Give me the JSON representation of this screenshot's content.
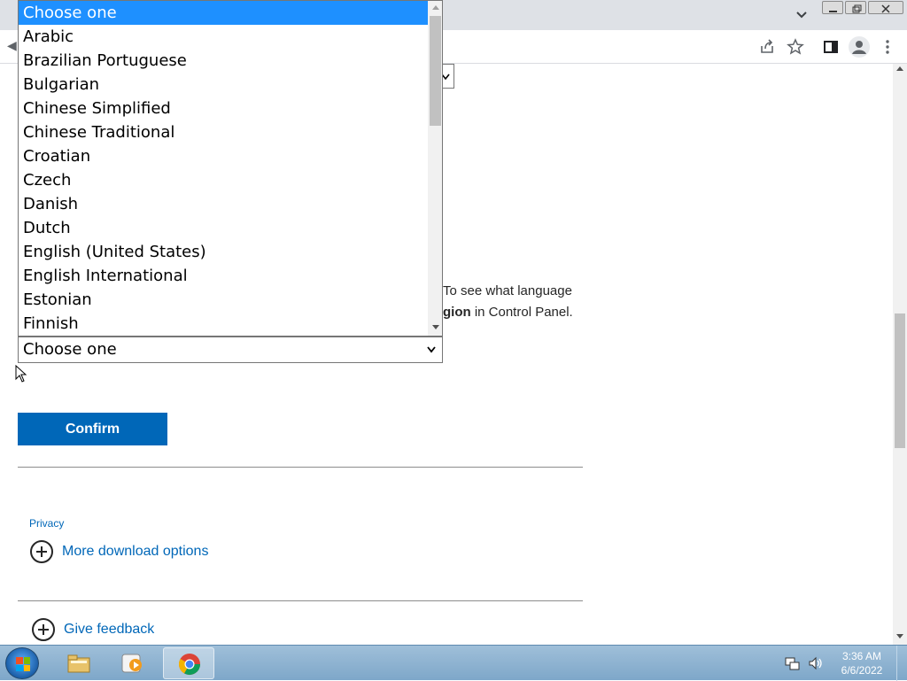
{
  "browser": {
    "title_icons": [
      "tab-list-chevron-icon",
      "minimize-icon",
      "restore-icon",
      "close-icon"
    ],
    "toolbar_icons": [
      "share-icon",
      "bookmark-star-icon",
      "side-panel-icon",
      "profile-icon",
      "more-menu-icon"
    ]
  },
  "page": {
    "description_line1": "To see what language",
    "description_line2_bold": "gion",
    "description_line2_rest": " in Control Panel.",
    "select_value": "Choose one",
    "confirm_label": "Confirm",
    "privacy_label": "Privacy",
    "more_options_label": "More download options",
    "feedback_label": "Give feedback"
  },
  "dropdown": {
    "options": [
      "Choose one",
      "Arabic",
      "Brazilian Portuguese",
      "Bulgarian",
      "Chinese Simplified",
      "Chinese Traditional",
      "Croatian",
      "Czech",
      "Danish",
      "Dutch",
      "English (United States)",
      "English International",
      "Estonian",
      "Finnish"
    ],
    "selected": "Choose one"
  },
  "taskbar": {
    "apps": [
      "file-explorer-icon",
      "media-player-icon",
      "chrome-icon"
    ],
    "time": "3:36 AM",
    "date": "6/6/2022"
  },
  "colors": {
    "accent": "#0067b8",
    "selected_option": "#1e90ff"
  }
}
